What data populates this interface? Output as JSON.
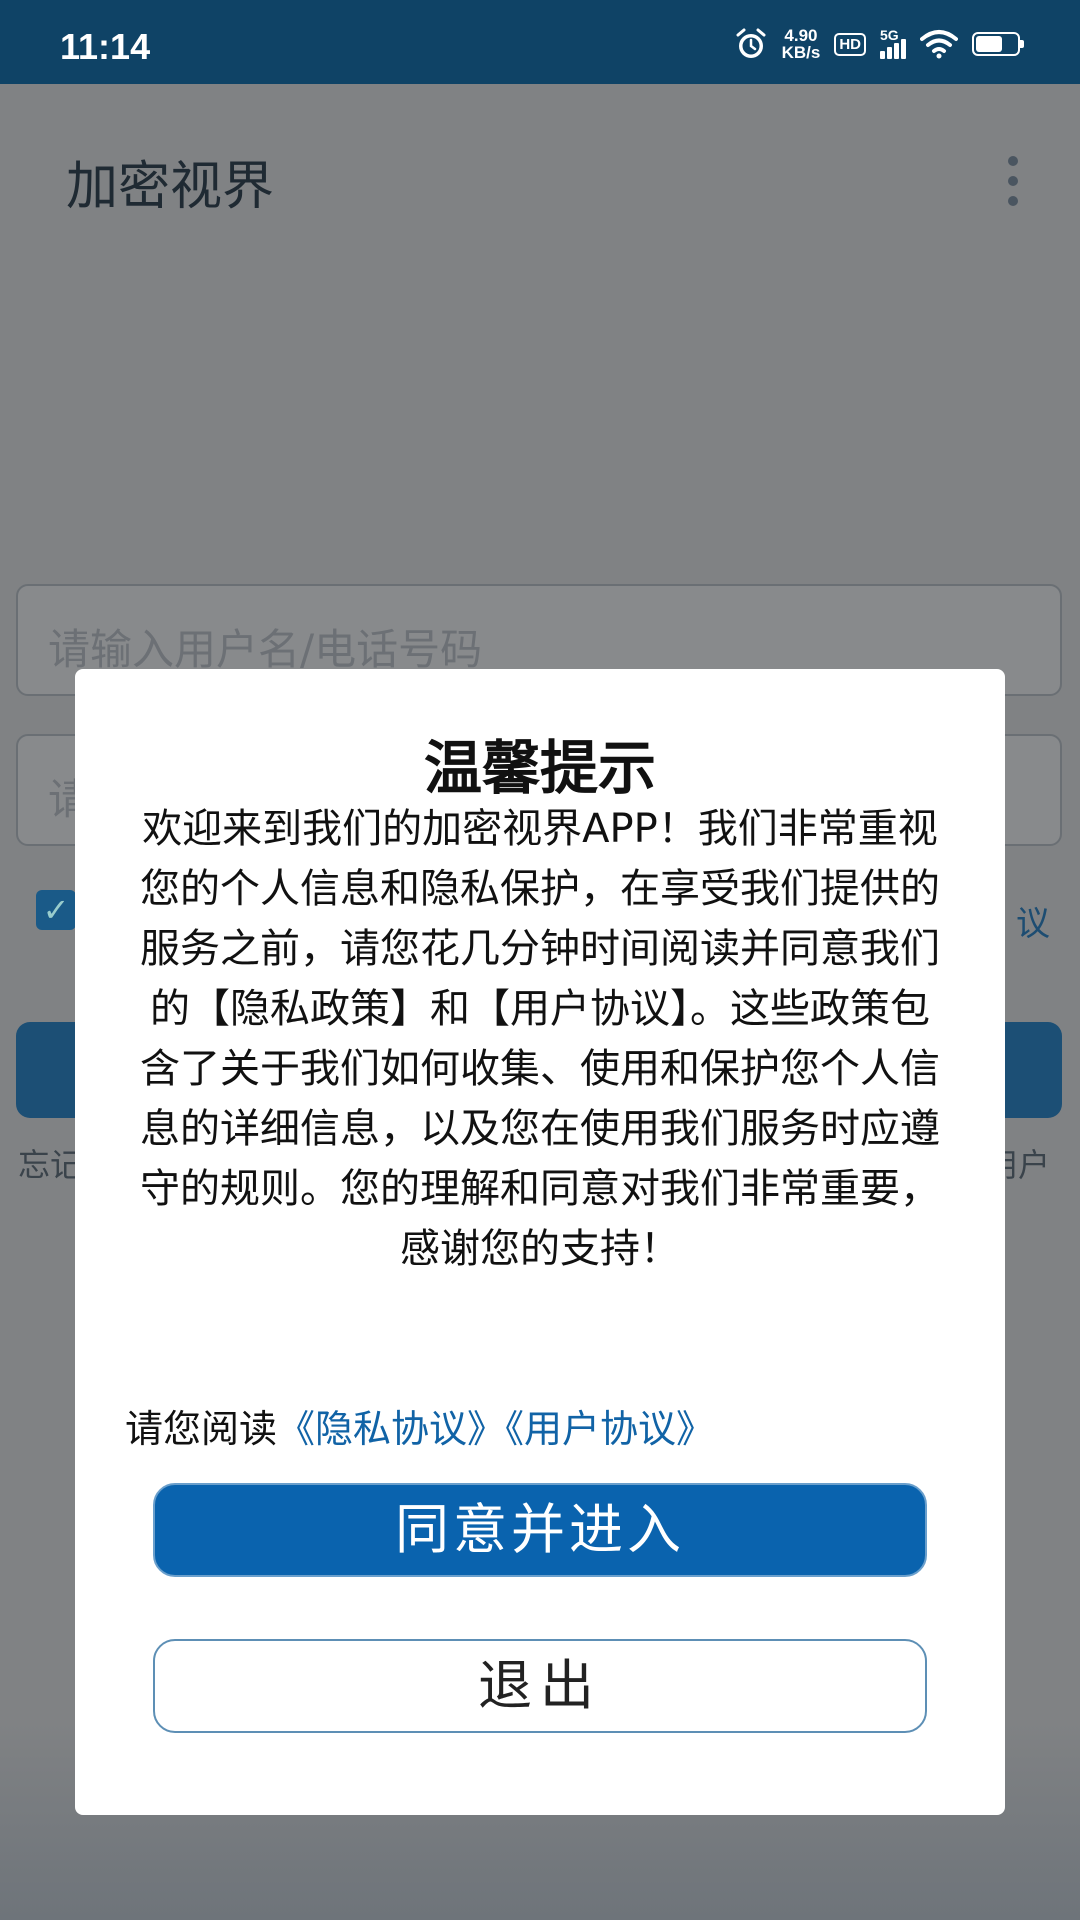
{
  "status_bar": {
    "time": "11:14",
    "speed_value": "4.90",
    "speed_unit": "KB/s",
    "hd": "HD",
    "network": "5G"
  },
  "app": {
    "title": "加密视界",
    "username_placeholder": "请输入用户名/电话号码",
    "password_placeholder_visible": "请",
    "agreement_fragment": "议",
    "forgot_fragment": "忘记",
    "register_fragment": "用户"
  },
  "dialog": {
    "title": "温馨提示",
    "body": "欢迎来到我们的加密视界APP！我们非常重视您的个人信息和隐私保护，在享受我们提供的服务之前，请您花几分钟时间阅读并同意我们的【隐私政策】和【用户协议】。这些政策包含了关于我们如何收集、使用和保护您个人信息的详细信息，以及您在使用我们服务时应遵守的规则。您的理解和同意对我们非常重要，感谢您的支持！",
    "read_prefix": "请您阅读",
    "privacy_link": "《隐私协议》",
    "user_link": "《用户协议》",
    "agree_button": "同意并进入",
    "exit_button": "退出"
  }
}
